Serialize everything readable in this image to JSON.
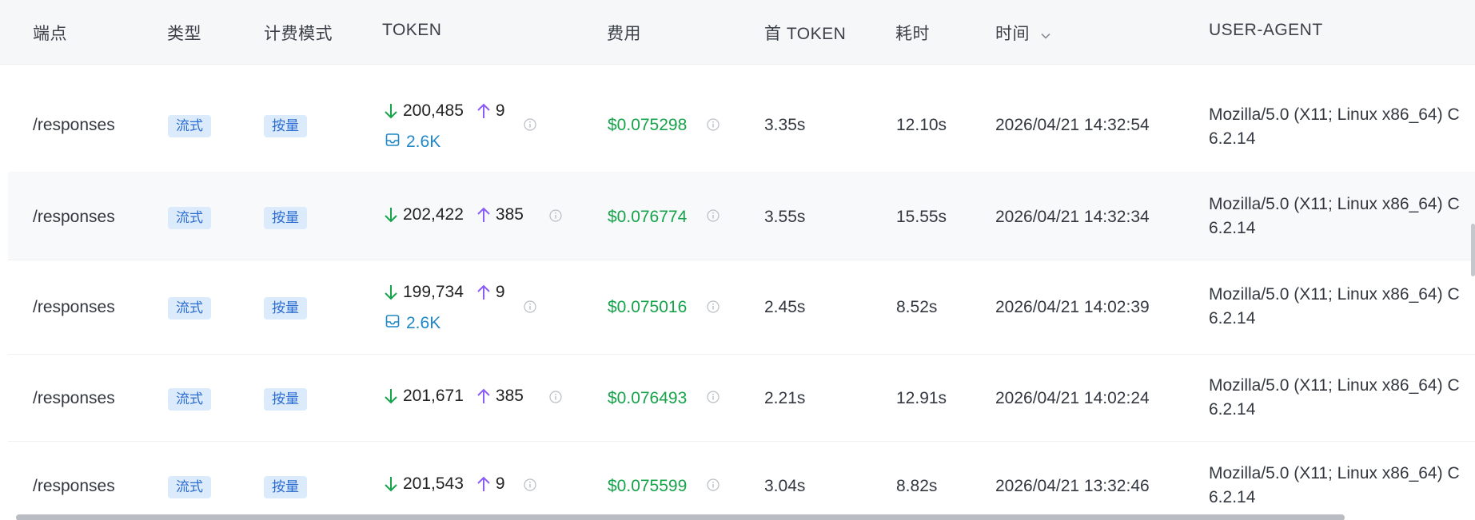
{
  "columns": {
    "endpoint": "端点",
    "type": "类型",
    "billing": "计费模式",
    "token": "TOKEN",
    "cost": "费用",
    "first_token": "首 TOKEN",
    "duration": "耗时",
    "time": "时间",
    "user_agent": "USER-AGENT"
  },
  "colors": {
    "cost": "#16a34a",
    "badge_text": "#2b6cd1",
    "badge_bg": "#dcebfb",
    "cache": "#1e88c9",
    "arrow_down": "#16a34a",
    "arrow_up": "#8b5cf6"
  },
  "rows": [
    {
      "endpoint": "/responses",
      "type": "流式",
      "billing": "按量",
      "input_tokens": "200,485",
      "output_tokens": "9",
      "cache": "2.6K",
      "cost": "$0.075298",
      "first_token": "3.35s",
      "duration": "12.10s",
      "time": "2026/04/21 14:32:54",
      "ua_line1": "Mozilla/5.0 (X11; Linux x86_64) C",
      "ua_line2": "6.2.14"
    },
    {
      "endpoint": "/responses",
      "type": "流式",
      "billing": "按量",
      "input_tokens": "202,422",
      "output_tokens": "385",
      "cost": "$0.076774",
      "first_token": "3.55s",
      "duration": "15.55s",
      "time": "2026/04/21 14:32:34",
      "ua_line1": "Mozilla/5.0 (X11; Linux x86_64) C",
      "ua_line2": "6.2.14"
    },
    {
      "endpoint": "/responses",
      "type": "流式",
      "billing": "按量",
      "input_tokens": "199,734",
      "output_tokens": "9",
      "cache": "2.6K",
      "cost": "$0.075016",
      "first_token": "2.45s",
      "duration": "8.52s",
      "time": "2026/04/21 14:02:39",
      "ua_line1": "Mozilla/5.0 (X11; Linux x86_64) C",
      "ua_line2": "6.2.14"
    },
    {
      "endpoint": "/responses",
      "type": "流式",
      "billing": "按量",
      "input_tokens": "201,671",
      "output_tokens": "385",
      "cost": "$0.076493",
      "first_token": "2.21s",
      "duration": "12.91s",
      "time": "2026/04/21 14:02:24",
      "ua_line1": "Mozilla/5.0 (X11; Linux x86_64) C",
      "ua_line2": "6.2.14"
    },
    {
      "endpoint": "/responses",
      "type": "流式",
      "billing": "按量",
      "input_tokens": "201,543",
      "output_tokens": "9",
      "cost": "$0.075599",
      "first_token": "3.04s",
      "duration": "8.82s",
      "time": "2026/04/21 13:32:46",
      "ua_line1": "Mozilla/5.0 (X11; Linux x86_64) C",
      "ua_line2": "6.2.14"
    }
  ]
}
